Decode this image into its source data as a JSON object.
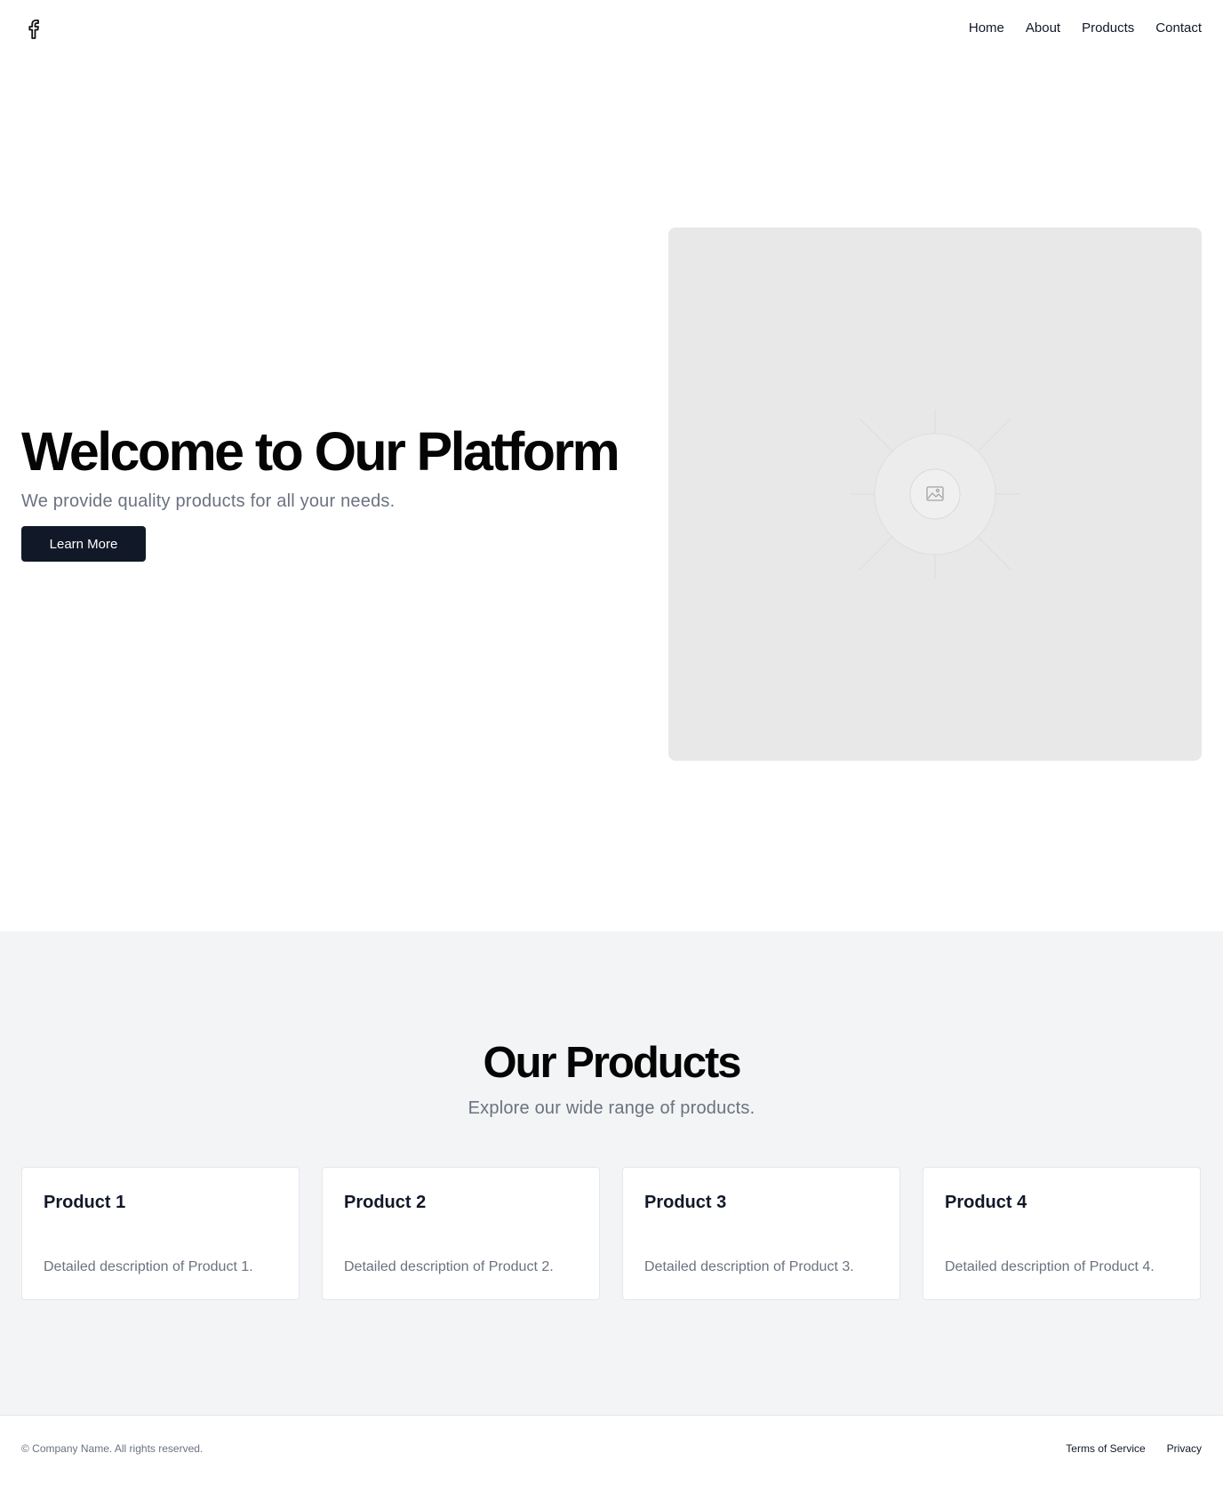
{
  "header": {
    "logo_icon": "facebook-icon",
    "nav": [
      {
        "label": "Home"
      },
      {
        "label": "About"
      },
      {
        "label": "Products"
      },
      {
        "label": "Contact"
      }
    ]
  },
  "hero": {
    "title": "Welcome to Our Platform",
    "subtitle": "We provide quality products for all your needs.",
    "button_label": "Learn More",
    "image_icon": "image-placeholder-icon"
  },
  "products": {
    "title": "Our Products",
    "subtitle": "Explore our wide range of products.",
    "items": [
      {
        "name": "Product 1",
        "description": "Detailed description of Product 1."
      },
      {
        "name": "Product 2",
        "description": "Detailed description of Product 2."
      },
      {
        "name": "Product 3",
        "description": "Detailed description of Product 3."
      },
      {
        "name": "Product 4",
        "description": "Detailed description of Product 4."
      }
    ]
  },
  "footer": {
    "copyright": "© Company Name. All rights reserved.",
    "links": [
      {
        "label": "Terms of Service"
      },
      {
        "label": "Privacy"
      }
    ]
  },
  "colors": {
    "primary_button": "#111827",
    "section_bg": "#f2f4f5",
    "image_placeholder_bg": "#e8e8e8",
    "muted_text": "#6b7280"
  }
}
